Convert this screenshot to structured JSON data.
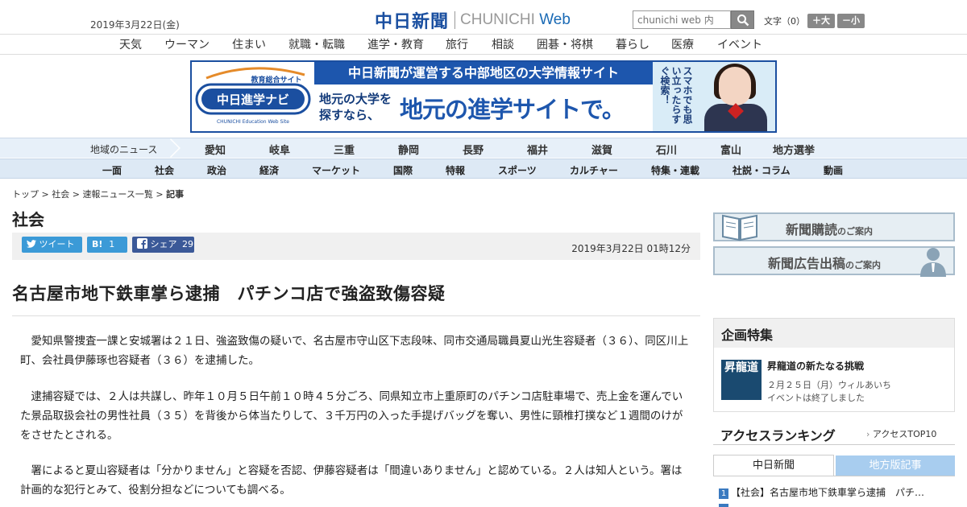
{
  "header": {
    "date": "2019年3月22日(金)",
    "logo_jp": "中日新聞",
    "logo_en_prefix": "CHUNICHI ",
    "logo_en_web": "Web",
    "search_placeholder": "chunichi web 内",
    "font_label": "文字（0）",
    "font_larger": "＋大",
    "font_smaller": "－小"
  },
  "genre_nav": [
    "天気",
    "ウーマン",
    "住まい",
    "就職・転職",
    "進学・教育",
    "旅行",
    "相談",
    "囲碁・将棋",
    "暮らし",
    "医療",
    "イベント"
  ],
  "banner": {
    "top_text": "中日新聞が運営する中部地区の大学情報サイト",
    "sub_text": "地元の大学を探すなら、",
    "main_text": "地元の進学サイトで。",
    "logo_top": "教育総合サイト",
    "logo_main": "中日進学ナビ",
    "logo_en": "CHUNICHI Education Web Site",
    "right_copy": "スマホでも思い立ったらすぐ検索！"
  },
  "region_nav": {
    "label": "地域のニュース",
    "items": [
      "愛知",
      "岐阜",
      "三重",
      "静岡",
      "長野",
      "福井",
      "滋賀",
      "石川",
      "富山",
      "地方選挙"
    ]
  },
  "category_nav": [
    "一面",
    "社会",
    "政治",
    "経済",
    "マーケット",
    "国際",
    "特報",
    "スポーツ",
    "カルチャー",
    "特集・連載",
    "社説・コラム",
    "動画"
  ],
  "breadcrumb": {
    "items": [
      "トップ",
      "社会",
      "速報ニュース一覧"
    ],
    "current": "記事",
    "sep": " > "
  },
  "section_title": "社会",
  "share": {
    "tweet": "ツイート",
    "hatena_icon": "B!",
    "hatena_count": "1",
    "facebook": "シェア",
    "facebook_count": "29"
  },
  "published": "2019年3月22日 01時12分",
  "article": {
    "headline": "名古屋市地下鉄車掌ら逮捕　パチンコ店で強盗致傷容疑",
    "paragraphs": [
      "愛知県警捜査一課と安城署は２１日、強盗致傷の疑いで、名古屋市守山区下志段味、同市交通局職員夏山光生容疑者（３６）、同区川上町、会社員伊藤琢也容疑者（３６）を逮捕した。",
      "逮捕容疑では、２人は共謀し、昨年１０月５日午前１０時４５分ごろ、同県知立市上重原町のパチンコ店駐車場で、売上金を運んでいた景品取扱会社の男性社員（３５）を背後から体当たりして、３千万円の入った手提げバッグを奪い、男性に頸椎打撲など１週間のけがをさせたとされる。",
      "署によると夏山容疑者は「分かりません」と容疑を否認、伊藤容疑者は「間違いありません」と認めている。２人は知人という。署は計画的な犯行とみて、役割分担などについても調べる。"
    ]
  },
  "sidebar": {
    "subscribe_main": "新聞購読",
    "subscribe_small": "のご案内",
    "ad_main": "新聞広告出稿",
    "ad_small": "のご案内",
    "kikaku": {
      "heading": "企画特集",
      "image_text": "昇龍道",
      "title": "昇龍道の新たなる挑戦",
      "line1": "２月２５日（月）ウィルあいち",
      "line2": "イベントは終了しました"
    },
    "ranking": {
      "heading": "アクセスランキング",
      "link": "アクセスTOP10",
      "tab_active": "中日新聞",
      "tab_inactive": "地方版記事",
      "item1_num": "1",
      "item1_text": "【社会】名古屋市地下鉄車掌ら逮捕　パチ…"
    }
  }
}
